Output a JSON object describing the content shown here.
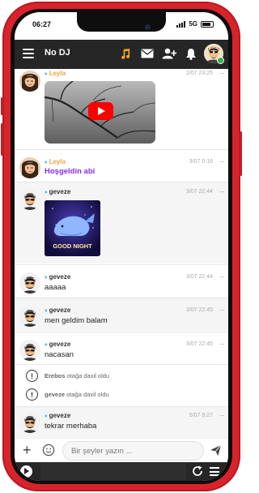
{
  "status_bar": {
    "time": "06:27",
    "network": "5G"
  },
  "header": {
    "title": "No DJ",
    "icons": [
      "menu-icon",
      "music-note-icon",
      "mail-icon",
      "add-friend-icon",
      "bell-icon",
      "user-avatar"
    ],
    "accent_color": "#f5a623"
  },
  "messages": [
    {
      "user": "Leyla",
      "time": "2/07 23:25",
      "type": "video",
      "user_color": "#f2a33c"
    },
    {
      "user": "Leyla",
      "time": "3/07 0:16",
      "type": "text",
      "text": "Hoşgeldin abi",
      "user_color": "#f2a33c",
      "text_color": "#8a2be2"
    },
    {
      "user": "geveze",
      "time": "3/07 22:44",
      "type": "gif",
      "gif_text": "GOOD NIGHT",
      "user_color": "#333333"
    },
    {
      "user": "geveze",
      "time": "3/07 22:44",
      "type": "text",
      "text": "aaaaa",
      "user_color": "#333333"
    },
    {
      "user": "geveze",
      "time": "3/07 22:45",
      "type": "text",
      "text": "men geldim balam",
      "user_color": "#333333"
    },
    {
      "user": "geveze",
      "time": "3/07 22:45",
      "type": "text",
      "text": "nacasan",
      "user_color": "#333333"
    }
  ],
  "system_messages": [
    {
      "user": "Erebos",
      "action": "otağa daxil oldu"
    },
    {
      "user": "geveze",
      "action": "otağa daxil oldu"
    }
  ],
  "last_message": {
    "user": "geveze",
    "time": "5/07 6:27",
    "text": "tekrar merhaba"
  },
  "composer": {
    "placeholder": "Bir şeyler yazın ..."
  },
  "bottom_bar": {
    "icons": [
      "play-icon",
      "refresh-icon",
      "list-icon"
    ]
  }
}
